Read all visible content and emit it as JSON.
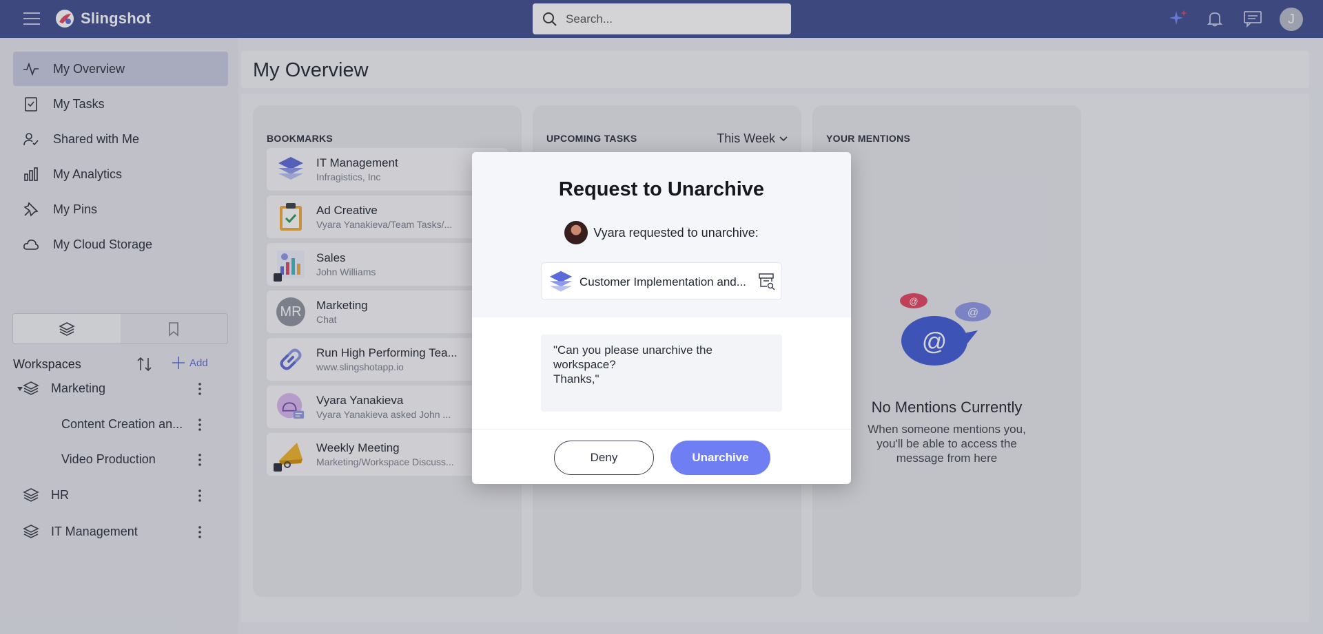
{
  "header": {
    "brand": "Slingshot",
    "search_placeholder": "Search...",
    "user_initial": "J"
  },
  "sidebar": {
    "nav": [
      {
        "label": "My Overview",
        "icon": "activity-icon",
        "active": true
      },
      {
        "label": "My Tasks",
        "icon": "task-check-icon"
      },
      {
        "label": "Shared with Me",
        "icon": "shared-user-icon"
      },
      {
        "label": "My Analytics",
        "icon": "bar-chart-icon"
      },
      {
        "label": "My Pins",
        "icon": "pin-icon"
      },
      {
        "label": "My Cloud Storage",
        "icon": "cloud-icon"
      }
    ],
    "workspaces_title": "Workspaces",
    "add_label": "Add",
    "workspaces": [
      {
        "label": "Marketing",
        "expanded": true
      },
      {
        "label": "Content Creation an..."
      },
      {
        "label": "Video Production"
      },
      {
        "label": "HR"
      },
      {
        "label": "IT Management"
      }
    ]
  },
  "main": {
    "page_title": "My Overview",
    "bookmarks": {
      "title": "BOOKMARKS",
      "items": [
        {
          "title": "IT Management",
          "subtitle": "Infragistics, Inc"
        },
        {
          "title": "Ad Creative",
          "subtitle": "Vyara Yanakieva/Team Tasks/..."
        },
        {
          "title": "Sales",
          "subtitle": "John Williams"
        },
        {
          "title": "Marketing",
          "subtitle": "Chat",
          "avatar": "MR"
        },
        {
          "title": "Run High Performing Tea...",
          "subtitle": "www.slingshotapp.io"
        },
        {
          "title": "Vyara Yanakieva",
          "subtitle": "Vyara Yanakieva asked John ..."
        },
        {
          "title": "Weekly Meeting",
          "subtitle": "Marketing/Workspace Discuss..."
        }
      ]
    },
    "tasks": {
      "title": "UPCOMING TASKS",
      "filter": "This Week"
    },
    "mentions": {
      "title": "YOUR MENTIONS",
      "empty_title": "No Mentions Currently",
      "empty_desc": "When someone mentions you, you'll be able to access the message from here"
    }
  },
  "modal": {
    "title": "Request to Unarchive",
    "requester_text": "Vyara requested to unarchive:",
    "workspace_label": "Customer Implementation and...",
    "message": "\"Can you please unarchive the workspace?\nThanks,\"",
    "deny_label": "Deny",
    "unarchive_label": "Unarchive"
  },
  "colors": {
    "topbar": "#3e4c8f",
    "accent": "#6f7ef2",
    "active_nav": "#c7cbe0"
  }
}
